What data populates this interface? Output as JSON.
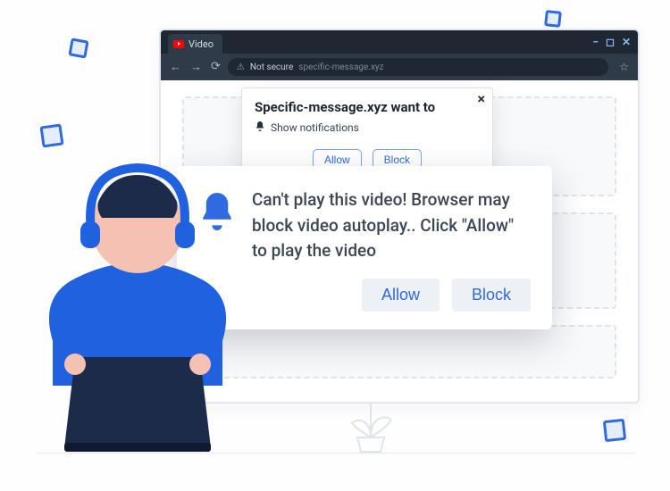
{
  "browser": {
    "tab_title": "Video",
    "toolbar": {
      "not_secure_label": "Not secure",
      "url": "specific-message.xyz"
    }
  },
  "perm_small": {
    "title": "Specific-message.xyz want to",
    "subtitle": "Show notifications",
    "allow": "Allow",
    "block": "Block"
  },
  "dialog_big": {
    "message": "Can't play this video! Browser may block video autoplay.. Click \"Allow\" to play the video",
    "allow": "Allow",
    "block": "Block"
  },
  "colors": {
    "accent": "#2f6ae1"
  }
}
